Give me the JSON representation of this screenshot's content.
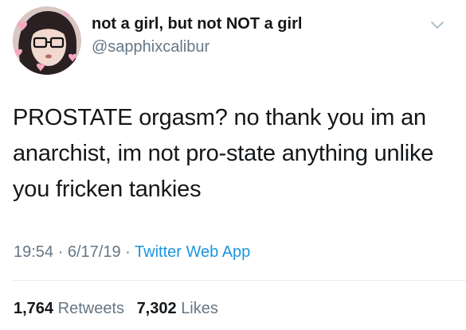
{
  "user": {
    "display_name": "not a girl, but not NOT a girl",
    "handle": "@sapphixcalibur"
  },
  "tweet": {
    "text": "PROSTATE orgasm? no thank you im an anarchist, im not pro-state anything unlike you fricken tankies",
    "time": "19:54",
    "date": "6/17/19",
    "separator": "·",
    "source": "Twitter Web App"
  },
  "stats": {
    "retweets_count": "1,764",
    "retweets_label": "Retweets",
    "likes_count": "7,302",
    "likes_label": "Likes"
  },
  "icons": {
    "menu": "chevron-down-icon"
  },
  "colors": {
    "text": "#14171a",
    "muted": "#657786",
    "link": "#1b95e0",
    "divider": "#e6ecf0"
  }
}
